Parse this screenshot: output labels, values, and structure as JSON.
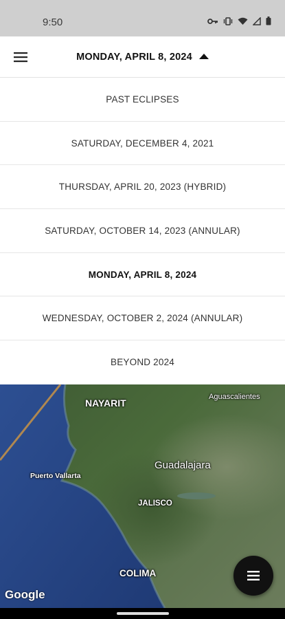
{
  "status_bar": {
    "time": "9:50",
    "icons": [
      "key-icon",
      "vibrate-icon",
      "wifi-icon",
      "signal-icon",
      "battery-icon"
    ]
  },
  "header": {
    "title": "MONDAY, APRIL 8, 2024",
    "menu_icon": "hamburger-menu-icon",
    "caret_icon": "caret-up-icon"
  },
  "dropdown": {
    "items": [
      {
        "label": "PAST ECLIPSES",
        "selected": false
      },
      {
        "label": "SATURDAY, DECEMBER 4, 2021",
        "selected": false
      },
      {
        "label": "THURSDAY, APRIL 20, 2023 (HYBRID)",
        "selected": false
      },
      {
        "label": "SATURDAY, OCTOBER 14, 2023 (ANNULAR)",
        "selected": false
      },
      {
        "label": "MONDAY, APRIL 8, 2024",
        "selected": true
      },
      {
        "label": "WEDNESDAY, OCTOBER 2, 2024 (ANNULAR)",
        "selected": false
      },
      {
        "label": "BEYOND 2024",
        "selected": false
      }
    ]
  },
  "map": {
    "labels": {
      "nayarit": "NAYARIT",
      "aguascalientes": "Aguascalientes",
      "puerto_vallarta": "Puerto Vallarta",
      "guadalajara": "Guadalajara",
      "jalisco": "JALISCO",
      "colima": "COLIMA"
    },
    "attribution": "Google",
    "fab_icon": "list-menu-icon"
  },
  "colors": {
    "status_bar": "#cfcfcf",
    "ocean": "#2a4a8a",
    "land": "#4a6a3a",
    "eclipse_path": "#b08850"
  }
}
